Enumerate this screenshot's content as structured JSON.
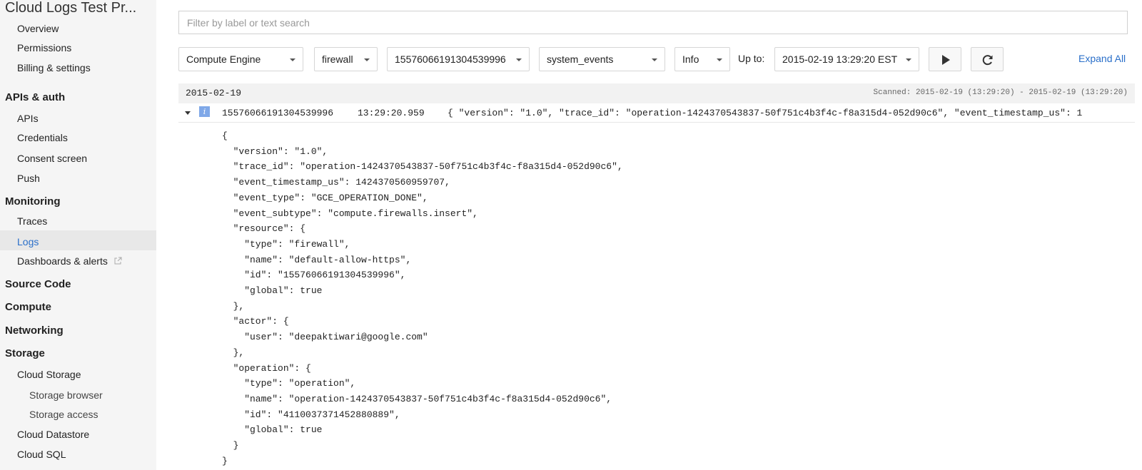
{
  "sidebar": {
    "project_title": "Cloud Logs Test Pr...",
    "groups": [
      {
        "label": "",
        "items": [
          "Overview",
          "Permissions",
          "Billing & settings"
        ]
      },
      {
        "label": "APIs & auth",
        "items": [
          "APIs",
          "Credentials",
          "Consent screen",
          "Push"
        ]
      },
      {
        "label": "Monitoring",
        "items": [
          "Traces",
          "Logs",
          "Dashboards & alerts"
        ]
      },
      {
        "label": "Source Code"
      },
      {
        "label": "Compute"
      },
      {
        "label": "Networking"
      },
      {
        "label": "Storage",
        "items": [
          "Cloud Storage",
          "Storage browser",
          "Storage access",
          "Cloud Datastore",
          "Cloud SQL"
        ]
      }
    ],
    "active_item": "Logs"
  },
  "filter": {
    "placeholder": "Filter by label or text search",
    "value": ""
  },
  "toolbar": {
    "service": "Compute Engine",
    "resource_type": "firewall",
    "resource_id": "15576066191304539996",
    "log_name": "system_events",
    "level": "Info",
    "upto_label": "Up to:",
    "upto_value": "2015-02-19 13:29:20 EST",
    "play_icon": "play-icon",
    "refresh_icon": "refresh-icon",
    "expand_all": "Expand All"
  },
  "logs": {
    "date": "2015-02-19",
    "scanned": "Scanned: 2015-02-19 (13:29:20) - 2015-02-19 (13:29:20)",
    "entry": {
      "severity_icon": "info-icon",
      "severity_glyph": "i",
      "id": "15576066191304539996",
      "time": "13:29:20.959",
      "summary": "{ \"version\": \"1.0\", \"trace_id\": \"operation-1424370543837-50f751c4b3f4c-f8a315d4-052d90c6\", \"event_timestamp_us\": 1",
      "payload": [
        "{",
        "  \"version\": \"1.0\",",
        "  \"trace_id\": \"operation-1424370543837-50f751c4b3f4c-f8a315d4-052d90c6\",",
        "  \"event_timestamp_us\": 1424370560959707,",
        "  \"event_type\": \"GCE_OPERATION_DONE\",",
        "  \"event_subtype\": \"compute.firewalls.insert\",",
        "  \"resource\": {",
        "    \"type\": \"firewall\",",
        "    \"name\": \"default-allow-https\",",
        "    \"id\": \"15576066191304539996\",",
        "    \"global\": true",
        "  },",
        "  \"actor\": {",
        "    \"user\": \"deepaktiwari@google.com\"",
        "  },",
        "  \"operation\": {",
        "    \"type\": \"operation\",",
        "    \"name\": \"operation-1424370543837-50f751c4b3f4c-f8a315d4-052d90c6\",",
        "    \"id\": \"4110037371452880889\",",
        "    \"global\": true",
        "  }",
        "}"
      ]
    }
  }
}
